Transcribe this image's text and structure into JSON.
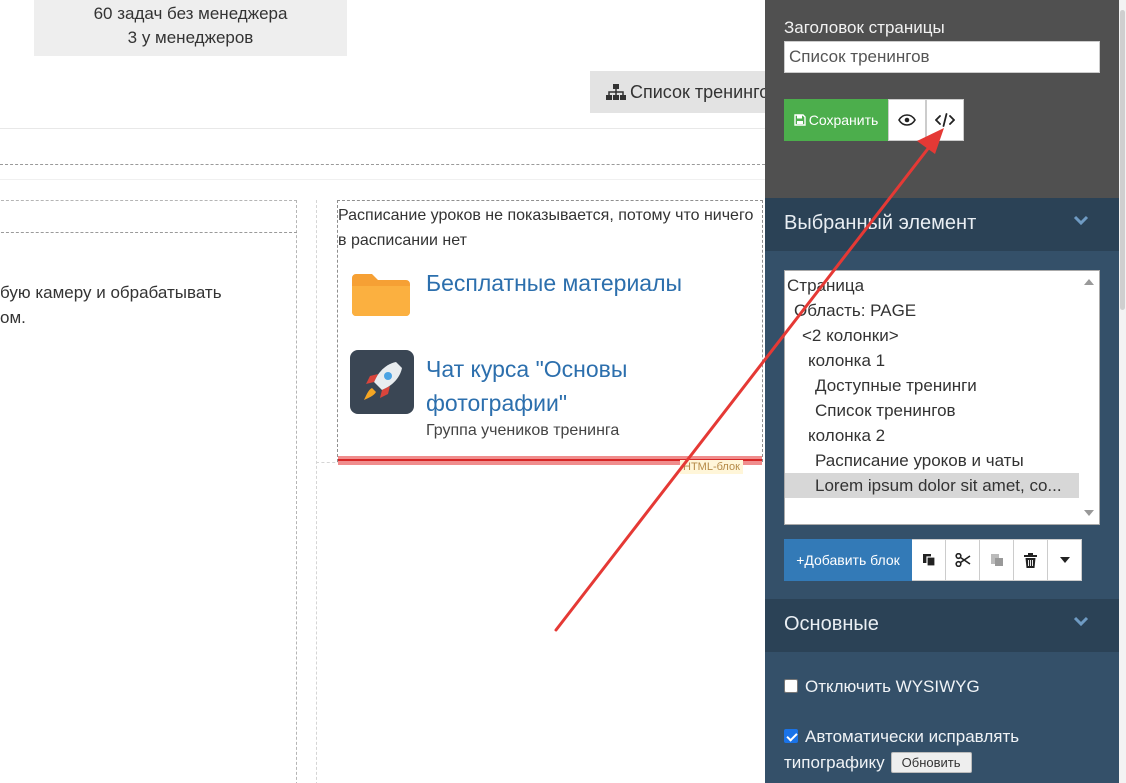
{
  "canvas": {
    "stats": {
      "line1": "60 задач без менеджера",
      "line2": "3 у менеджеров"
    },
    "list_button_label": "Список тренингов",
    "col1_text": "бую камеру и обрабатывать\nом.",
    "schedule_note": "Расписание уроков не показывается, потому что ничего в расписании нет",
    "items": [
      {
        "title": "Бесплатные материалы",
        "icon": "folder-icon"
      },
      {
        "title": "Чат курса \"Основы\nфотографии\"",
        "subtitle": "Группа учеников тренинга",
        "icon": "rocket-icon"
      }
    ],
    "block_tag": "HTML-блок"
  },
  "panel": {
    "page_title_label": "Заголовок страницы",
    "page_title_value": "Список тренингов",
    "save_label": "Сохранить",
    "selected_section": "Выбранный элемент",
    "tree": [
      {
        "label": "Страница",
        "indent": 0
      },
      {
        "label": "Область: PAGE",
        "indent": 1
      },
      {
        "label": "<2 колонки>",
        "indent": 2
      },
      {
        "label": "колонка 1",
        "indent": 3
      },
      {
        "label": "Доступные тренинги",
        "indent": 4
      },
      {
        "label": "Список тренингов",
        "indent": 4
      },
      {
        "label": "колонка 2",
        "indent": 3
      },
      {
        "label": "Расписание уроков и чаты",
        "indent": 4
      },
      {
        "label": "Lorem ipsum dolor sit amet, co...",
        "indent": 4,
        "selected": true
      }
    ],
    "add_block_label": "+Добавить блок",
    "main_section": "Основные",
    "options": {
      "disable_wysiwyg": "Отключить WYSIWYG",
      "disable_wysiwyg_checked": false,
      "auto_typography": "Автоматически исправлять типографику",
      "auto_typography_checked": true,
      "refresh_label": "Обновить"
    }
  },
  "colors": {
    "panel_bg": "#345069",
    "panel_top_bg": "#505050",
    "save_green": "#4cae4c",
    "add_blue": "#337ab7",
    "link_blue": "#2c6fad",
    "arrow_red": "#e53935"
  }
}
